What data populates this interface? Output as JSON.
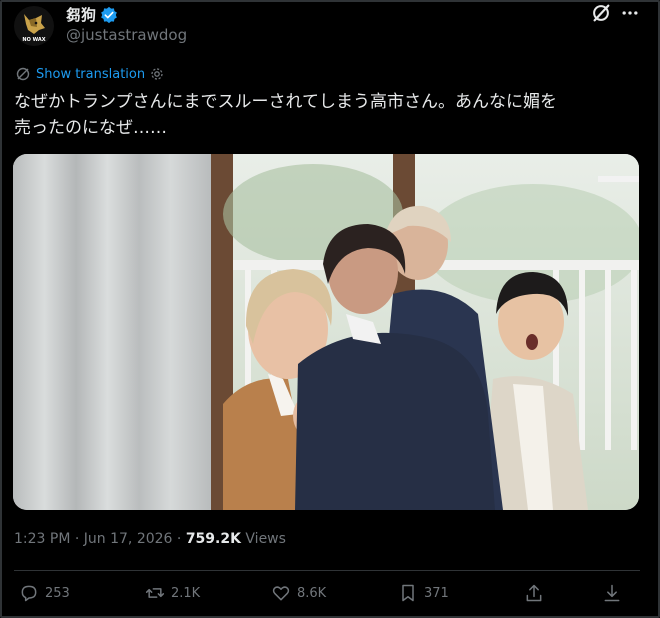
{
  "author": {
    "display_name": "芻狗",
    "handle": "@justastrawdog",
    "avatar_text": "NO WAX",
    "verified": true
  },
  "translate": {
    "label": "Show translation"
  },
  "tweet": {
    "text_line1": "なぜかトランプさんにまでスルーされてしまう高市さん。あんなに媚を",
    "text_line2": "売ったのになぜ……"
  },
  "meta": {
    "time": "1:23 PM",
    "date": "Jun 17, 2026",
    "separator": "·",
    "views_count": "759.2K",
    "views_label": "Views"
  },
  "actions": {
    "replies": "253",
    "reposts": "2.1K",
    "likes": "8.6K",
    "bookmarks": "371"
  },
  "colors": {
    "background": "#000000",
    "text": "#e7e9ea",
    "muted": "#71767b",
    "link": "#1d9bf0",
    "border": "#2f3336"
  },
  "icons": [
    "verified-badge-icon",
    "grok-icon",
    "more-icon",
    "translate-gear-icon",
    "reply-icon",
    "repost-icon",
    "like-icon",
    "bookmark-icon",
    "share-icon",
    "download-icon"
  ]
}
